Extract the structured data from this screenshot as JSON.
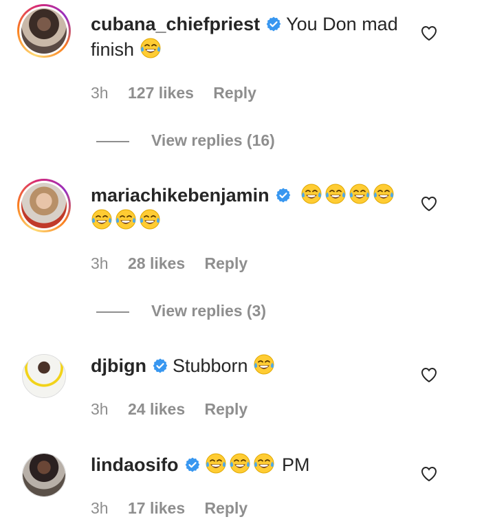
{
  "comments": [
    {
      "username": "cubana_chiefpriest",
      "text": "You Don mad finish",
      "emoji_count": 1,
      "time": "3h",
      "likes": "127 likes",
      "reply_label": "Reply",
      "view_replies": "View replies (16)",
      "avatar_ring": true
    },
    {
      "username": "mariachikebenjamin",
      "text": "",
      "emoji_count": 7,
      "time": "3h",
      "likes": "28 likes",
      "reply_label": "Reply",
      "view_replies": "View replies (3)",
      "avatar_ring": true
    },
    {
      "username": "djbign",
      "text": "Stubborn",
      "emoji_count": 1,
      "time": "3h",
      "likes": "24 likes",
      "reply_label": "Reply",
      "avatar_ring": false
    },
    {
      "username": "lindaosifo",
      "text": "PM",
      "emoji_count": 3,
      "time": "3h",
      "likes": "17 likes",
      "reply_label": "Reply",
      "avatar_ring": false
    }
  ],
  "colors": {
    "verified": "#3897f0",
    "muted": "#8e8e8e",
    "text": "#262626"
  },
  "icons": {
    "verified": "verified-badge-icon",
    "like": "heart-outline-icon",
    "emoji": "face-with-tears-of-joy-emoji"
  }
}
